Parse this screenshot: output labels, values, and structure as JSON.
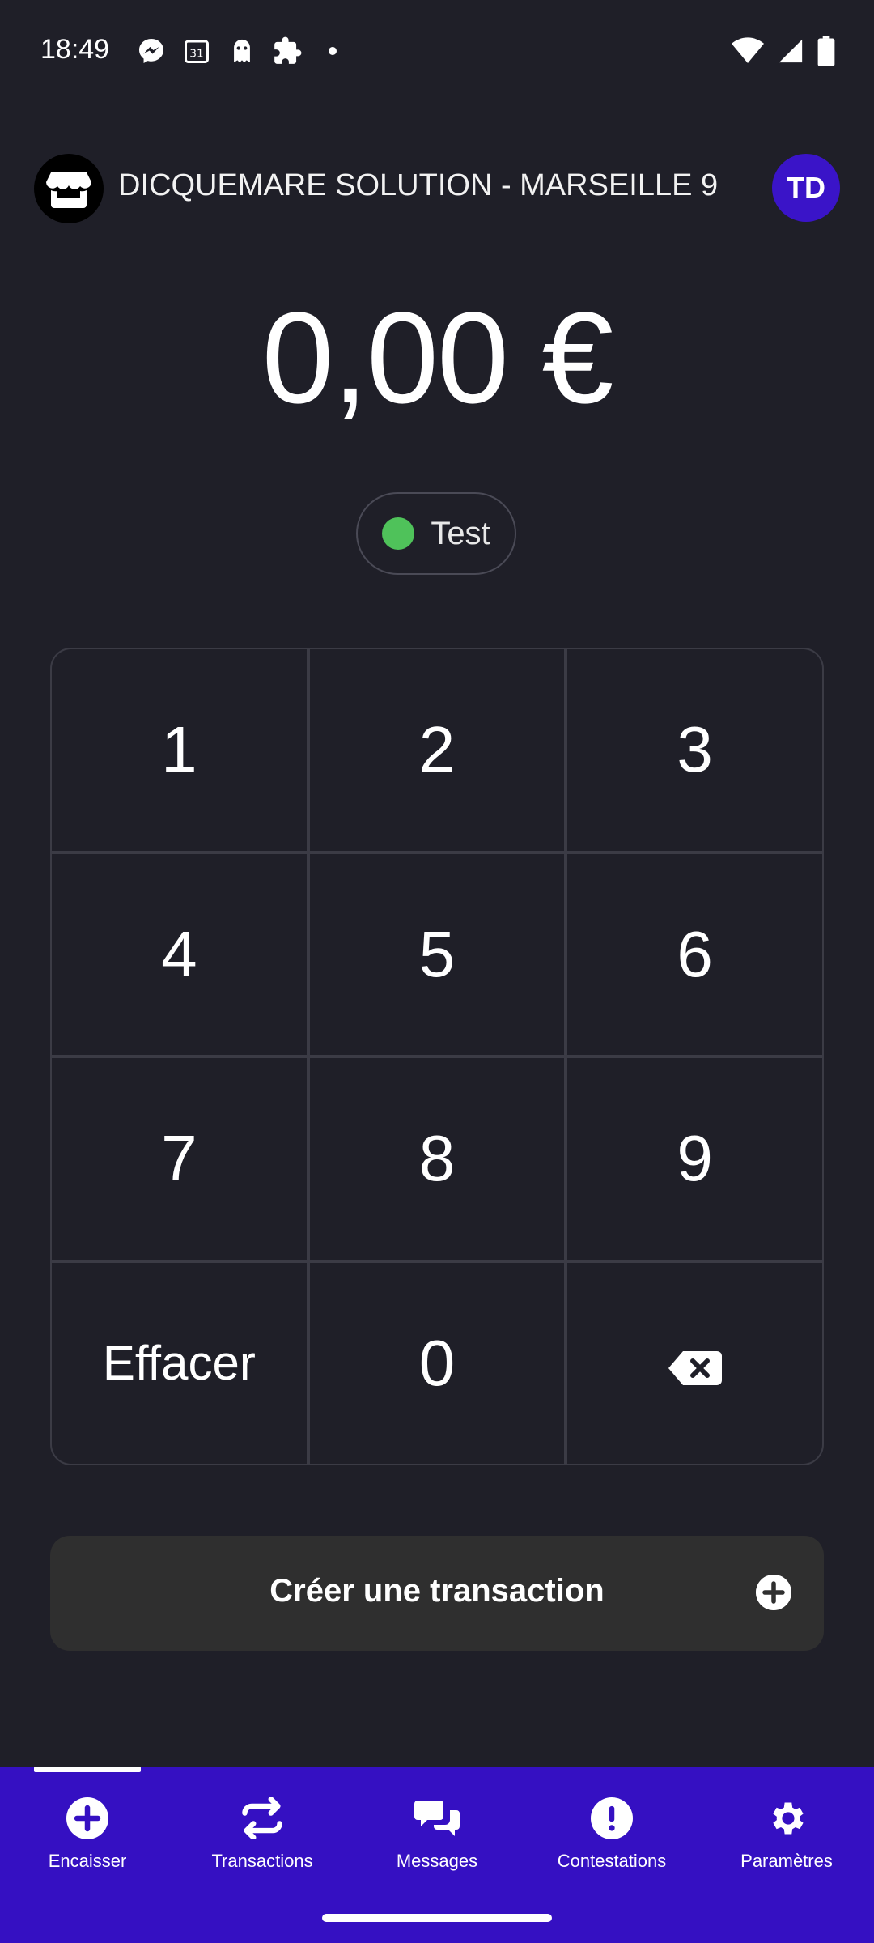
{
  "status_bar": {
    "time": "18:49",
    "icons": [
      "messenger-icon",
      "calendar-icon",
      "ghost-icon",
      "puzzle-icon",
      "dot-icon"
    ],
    "right_icons": [
      "wifi-icon",
      "signal-icon",
      "battery-icon"
    ],
    "calendar_day": "31"
  },
  "header": {
    "store_name": "DICQUEMARE SOLUTION - MARSEILLE 9",
    "avatar_initials": "TD"
  },
  "amount": {
    "value": "0,00 €"
  },
  "mode": {
    "label": "Test",
    "indicator_color": "#4fc25a"
  },
  "keypad": {
    "k1": "1",
    "k2": "2",
    "k3": "3",
    "k4": "4",
    "k5": "5",
    "k6": "6",
    "k7": "7",
    "k8": "8",
    "k9": "9",
    "clear": "Effacer",
    "k0": "0",
    "backspace_icon": "backspace-icon"
  },
  "create_button": {
    "label": "Créer une transaction",
    "icon": "plus-circle-icon"
  },
  "bottom_nav": {
    "items": [
      {
        "label": "Encaisser",
        "icon": "plus-circle-icon",
        "active": true
      },
      {
        "label": "Transactions",
        "icon": "transfer-arrows-icon",
        "active": false
      },
      {
        "label": "Messages",
        "icon": "chat-bubbles-icon",
        "active": false
      },
      {
        "label": "Contestations",
        "icon": "exclamation-circle-icon",
        "active": false
      },
      {
        "label": "Paramètres",
        "icon": "gear-icon",
        "active": false
      }
    ]
  },
  "colors": {
    "background": "#1f1f28",
    "accent": "#3510c2",
    "avatar": "#3a14c8",
    "button": "#2f2f2f"
  }
}
